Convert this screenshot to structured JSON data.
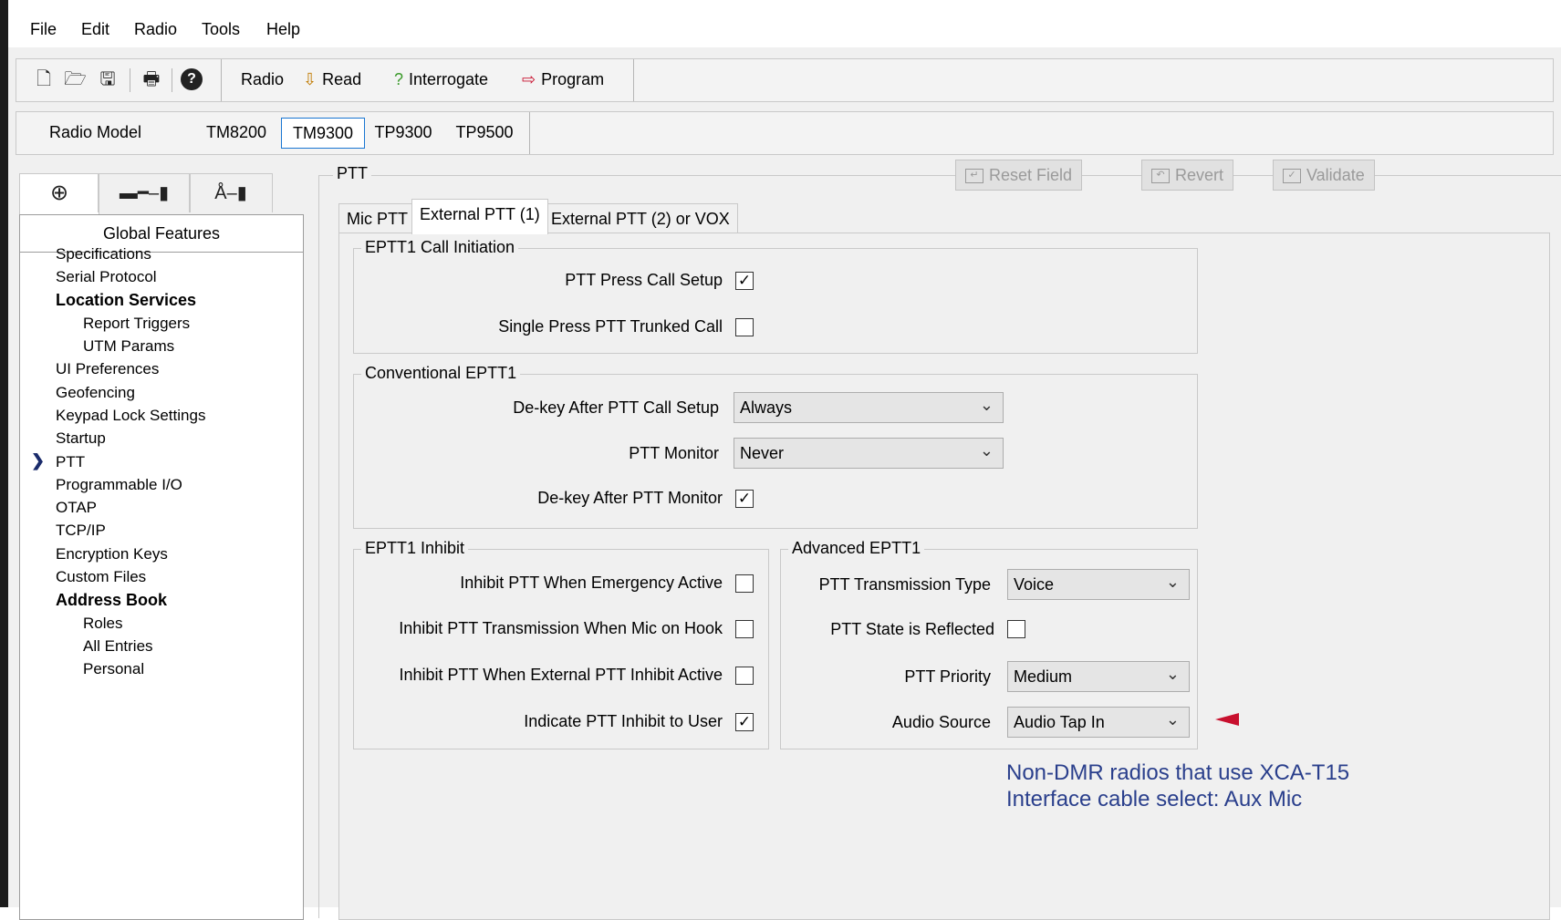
{
  "menu": [
    "File",
    "Edit",
    "Radio",
    "Tools",
    "Help"
  ],
  "toolbar": {
    "icons": [
      "new-file-icon",
      "open-icon",
      "save-icon",
      "print-icon",
      "help-icon"
    ],
    "radio_label": "Radio",
    "read_label": "Read",
    "interrogate_label": "Interrogate",
    "program_label": "Program"
  },
  "model_bar": {
    "label": "Radio Model",
    "models": [
      "TM8200",
      "TM9300",
      "TP9300",
      "TP9500"
    ],
    "selected": "TM9300"
  },
  "nav": {
    "icon_tabs": [
      "globe-icon",
      "accessory-icon",
      "antenna-icon"
    ],
    "header": "Global Features",
    "items": [
      {
        "label": "Specifications",
        "level": 0,
        "bold": false
      },
      {
        "label": "Serial Protocol",
        "level": 0,
        "bold": false
      },
      {
        "label": "Location Services",
        "level": 0,
        "bold": true
      },
      {
        "label": "Report Triggers",
        "level": 1,
        "bold": false
      },
      {
        "label": "UTM Params",
        "level": 1,
        "bold": false
      },
      {
        "label": "UI Preferences",
        "level": 0,
        "bold": false
      },
      {
        "label": "Geofencing",
        "level": 0,
        "bold": false
      },
      {
        "label": "Keypad Lock Settings",
        "level": 0,
        "bold": false
      },
      {
        "label": "Startup",
        "level": 0,
        "bold": false
      },
      {
        "label": "PTT",
        "level": 0,
        "bold": false,
        "selected": true
      },
      {
        "label": "Programmable I/O",
        "level": 0,
        "bold": false
      },
      {
        "label": "OTAP",
        "level": 0,
        "bold": false
      },
      {
        "label": "TCP/IP",
        "level": 0,
        "bold": false
      },
      {
        "label": "Encryption Keys",
        "level": 0,
        "bold": false
      },
      {
        "label": "Custom Files",
        "level": 0,
        "bold": false
      },
      {
        "label": "Address Book",
        "level": 0,
        "bold": true
      },
      {
        "label": "Roles",
        "level": 1,
        "bold": false
      },
      {
        "label": "All Entries",
        "level": 1,
        "bold": false
      },
      {
        "label": "Personal",
        "level": 1,
        "bold": false
      }
    ]
  },
  "ptt": {
    "title": "PTT",
    "actions": [
      "Reset Field",
      "Revert",
      "Validate"
    ],
    "tabs": [
      "Mic PTT",
      "External PTT (1)",
      "External PTT (2) or VOX"
    ],
    "selected_tab": "External PTT (1)",
    "call_initiation": {
      "title": "EPTT1 Call Initiation",
      "fields": [
        {
          "label": "PTT Press Call Setup",
          "checked": true
        },
        {
          "label": "Single Press PTT Trunked Call",
          "checked": false
        }
      ]
    },
    "conventional": {
      "title": "Conventional EPTT1",
      "dekey_after_setup_label": "De-key After PTT Call Setup",
      "dekey_after_setup_value": "Always",
      "monitor_label": "PTT Monitor",
      "monitor_value": "Never",
      "dekey_after_monitor_label": "De-key After PTT Monitor",
      "dekey_after_monitor_checked": true
    },
    "inhibit": {
      "title": "EPTT1 Inhibit",
      "fields": [
        {
          "label": "Inhibit PTT When Emergency Active",
          "checked": false
        },
        {
          "label": "Inhibit PTT Transmission When Mic on Hook",
          "checked": false
        },
        {
          "label": "Inhibit PTT When External PTT Inhibit Active",
          "checked": false
        },
        {
          "label": "Indicate PTT Inhibit to User",
          "checked": true
        }
      ]
    },
    "advanced": {
      "title": "Advanced EPTT1",
      "transmission_type_label": "PTT Transmission Type",
      "transmission_type_value": "Voice",
      "state_reflected_label": "PTT State is Reflected",
      "state_reflected_checked": false,
      "priority_label": "PTT Priority",
      "priority_value": "Medium",
      "audio_source_label": "Audio Source",
      "audio_source_value": "Audio Tap In"
    }
  },
  "annotation": {
    "line1": "Non-DMR  radios that use XCA-T15",
    "line2": "Interface cable select: Aux Mic",
    "color": "#2a3f8c",
    "pointer_color": "#c8102e"
  }
}
